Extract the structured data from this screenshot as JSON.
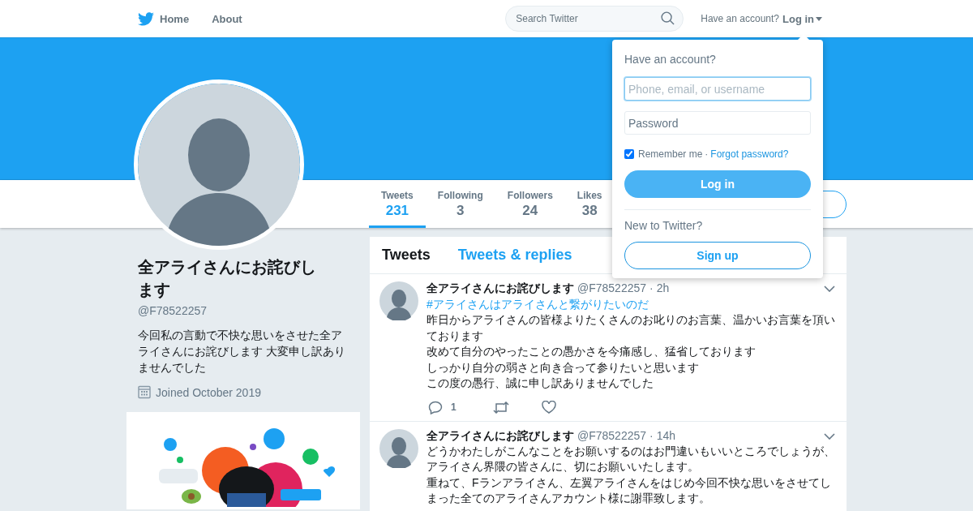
{
  "nav": {
    "items": [
      {
        "label": "Home",
        "kind": "home"
      },
      {
        "label": "About",
        "kind": "plain"
      }
    ],
    "search": {
      "placeholder": "Search Twitter"
    },
    "account_prompt": "Have an account?",
    "login_menu": "Log in"
  },
  "stats": [
    {
      "label": "Tweets",
      "value": "231",
      "selected": true
    },
    {
      "label": "Following",
      "value": "3",
      "selected": false
    },
    {
      "label": "Followers",
      "value": "24",
      "selected": false
    },
    {
      "label": "Likes",
      "value": "38",
      "selected": false
    }
  ],
  "profile": {
    "name": "全アライさんにお詫びします",
    "handle": "@F78522257",
    "bio": "今回私の言動で不快な思いをさせた全アライさんにお詫びします 大変申し訳ありませんでした",
    "joined": "Joined October 2019"
  },
  "timeline": {
    "tabs": [
      {
        "label": "Tweets",
        "selected": true
      },
      {
        "label": "Tweets & replies",
        "selected": false
      }
    ],
    "tweets": [
      {
        "name": "全アライさんにお詫びします",
        "handle": "@F78522257",
        "time": "2h",
        "hashtag": "#アライさんはアライさんと繋がりたいのだ",
        "separator": "·",
        "lines": [
          "昨日からアライさんの皆様よりたくさんのお叱りのお言葉、温かいお言葉を頂いております",
          "改めて自分のやったことの愚かさを今痛感し、猛省しております",
          "しっかり自分の弱さと向き合って参りたいと思います",
          "この度の愚行、誠に申し訳ありませんでした"
        ],
        "replies": "1"
      },
      {
        "name": "全アライさんにお詫びします",
        "handle": "@F78522257",
        "time": "14h",
        "separator": "·",
        "lines": [
          "どうかわたしがこんなことをお願いするのはお門違いもいいところでしょうが、",
          "アライさん界隈の皆さんに、切にお願いいたします。",
          "重ねて、Fランアライさん、左翼アライさんをはじめ今回不快な思いをさせてしまった全てのアライさんアカウント様に謝罪致します。"
        ]
      }
    ]
  },
  "login_dropdown": {
    "title": "Have an account?",
    "username": {
      "placeholder": "Phone, email, or username",
      "focused": true
    },
    "password": {
      "placeholder": "Password"
    },
    "remember": {
      "label": "Remember me",
      "checked": true
    },
    "separator": "·",
    "forgot": "Forgot password?",
    "login_button": "Log in",
    "signup_prompt": "New to Twitter?",
    "signup_button": "Sign up"
  }
}
